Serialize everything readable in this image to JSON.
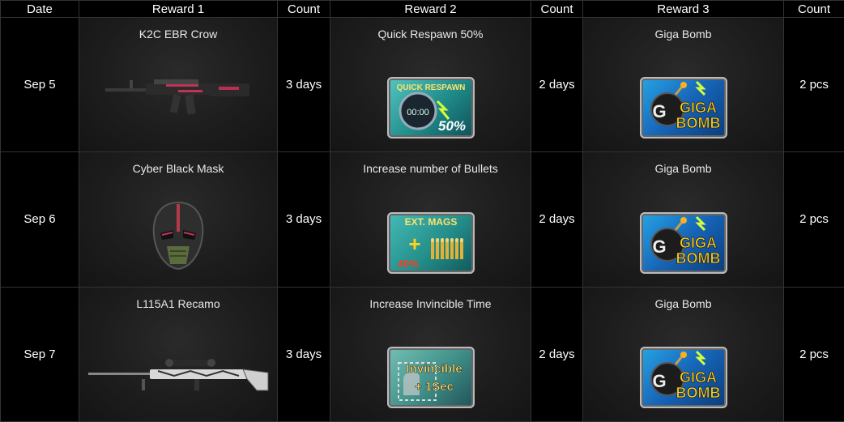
{
  "headers": [
    "Date",
    "Reward 1",
    "Count",
    "Reward 2",
    "Count",
    "Reward 3",
    "Count"
  ],
  "rows": [
    {
      "date": "Sep 5",
      "reward1": {
        "name": "K2C EBR Crow",
        "icon": "rifle-icon"
      },
      "count1": "3 days",
      "reward2": {
        "name": "Quick Respawn 50%",
        "icon": "quick-respawn-icon",
        "badge_text": [
          "QUICK RESPAWN",
          "00:00",
          "50%"
        ]
      },
      "count2": "2 days",
      "reward3": {
        "name": "Giga Bomb",
        "icon": "giga-bomb-icon",
        "badge_text": [
          "G",
          "GIGA",
          "BOMB"
        ]
      },
      "count3": "2 pcs"
    },
    {
      "date": "Sep 6",
      "reward1": {
        "name": "Cyber Black Mask",
        "icon": "mask-icon"
      },
      "count1": "3 days",
      "reward2": {
        "name": "Increase number of Bullets",
        "icon": "ext-mags-icon",
        "badge_text": [
          "EXT. MAGS",
          "+",
          "40%"
        ]
      },
      "count2": "2 days",
      "reward3": {
        "name": "Giga Bomb",
        "icon": "giga-bomb-icon",
        "badge_text": [
          "G",
          "GIGA",
          "BOMB"
        ]
      },
      "count3": "2 pcs"
    },
    {
      "date": "Sep 7",
      "reward1": {
        "name": "L115A1 Recamo",
        "icon": "sniper-rifle-icon"
      },
      "count1": "3 days",
      "reward2": {
        "name": "Increase Invincible Time",
        "icon": "invincible-icon",
        "badge_text": [
          "Invincible",
          "+ 1Sec"
        ]
      },
      "count2": "2 days",
      "reward3": {
        "name": "Giga Bomb",
        "icon": "giga-bomb-icon",
        "badge_text": [
          "G",
          "GIGA",
          "BOMB"
        ]
      },
      "count3": "2 pcs"
    }
  ],
  "colors": {
    "background": "#000000",
    "cell_bg": "#1d1d1d",
    "border": "#333333",
    "text": "#ffffff"
  }
}
